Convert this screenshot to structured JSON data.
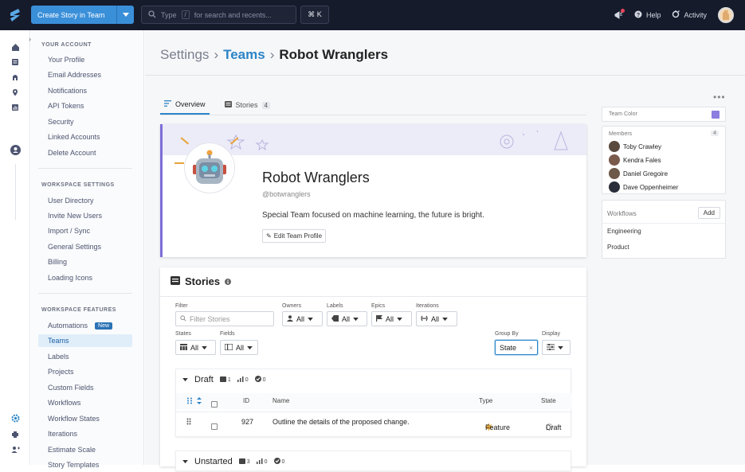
{
  "topbar": {
    "create_label": "Create Story in Team",
    "search_placeholder_pre": "Type",
    "search_key": "/",
    "search_placeholder_post": "for search and recents...",
    "shortcut": "⌘ K",
    "help": "Help",
    "activity": "Activity"
  },
  "sidebar": {
    "section_account": "YOUR ACCOUNT",
    "account_items": [
      "Your Profile",
      "Email Addresses",
      "Notifications",
      "API Tokens",
      "Security",
      "Linked Accounts",
      "Delete Account"
    ],
    "section_workspace": "WORKSPACE SETTINGS",
    "workspace_items": [
      "User Directory",
      "Invite New Users",
      "Import / Sync",
      "General Settings",
      "Billing",
      "Loading Icons"
    ],
    "section_features": "WORKSPACE FEATURES",
    "feature_items": [
      "Automations",
      "Teams",
      "Labels",
      "Projects",
      "Custom Fields",
      "Workflows",
      "Workflow States",
      "Iterations",
      "Estimate Scale",
      "Story Templates"
    ],
    "new_badge": "New"
  },
  "breadcrumb": {
    "root": "Settings",
    "parent": "Teams",
    "current": "Robot Wranglers"
  },
  "tabs": {
    "overview": "Overview",
    "stories": "Stories",
    "stories_count": "4"
  },
  "team": {
    "name": "Robot Wranglers",
    "handle": "@botwranglers",
    "description": "Special Team focused on machine learning, the future is bright.",
    "edit_label": "Edit Team Profile",
    "color": "#8b7ee0"
  },
  "stories_panel": {
    "title": "Stories",
    "filter_label": "Filter",
    "filter_placeholder": "Filter Stories",
    "owners_label": "Owners",
    "labels_label": "Labels",
    "epics_label": "Epics",
    "iterations_label": "Iterations",
    "states_label": "States",
    "fields_label": "Fields",
    "group_by_label": "Group By",
    "display_label": "Display",
    "all": "All",
    "group_by_value": "State"
  },
  "groups": [
    {
      "name": "Draft",
      "stories": "1",
      "points": "0",
      "done": "0",
      "columns": {
        "id": "ID",
        "name": "Name",
        "type": "Type",
        "state": "State"
      },
      "rows": [
        {
          "id": "927",
          "name": "Outline the details of the proposed change.",
          "type": "Feature",
          "state": "Draft"
        }
      ]
    },
    {
      "name": "Unstarted",
      "stories": "3",
      "points": "0",
      "done": "0"
    }
  ],
  "right_panel": {
    "team_color_label": "Team Color",
    "members_label": "Members",
    "members_count": "4",
    "members": [
      "Toby Crawley",
      "Kendra Fales",
      "Daniel Gregoire",
      "Dave Oppenheimer"
    ],
    "workflows_label": "Workflows",
    "add_label": "Add",
    "workflows": [
      "Engineering",
      "Product"
    ]
  }
}
